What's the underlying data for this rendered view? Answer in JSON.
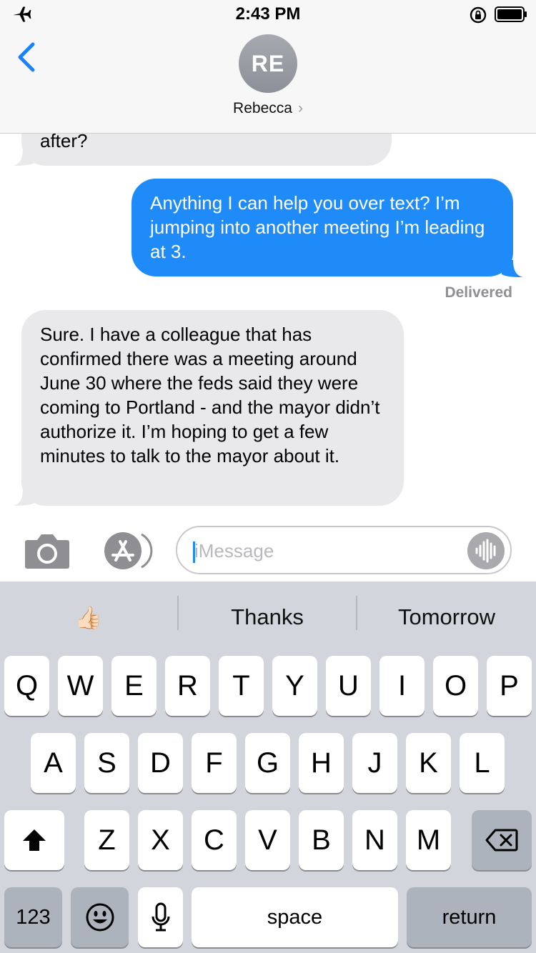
{
  "status_bar": {
    "time": "2:43 PM"
  },
  "header": {
    "back_icon": "chevron-left-icon",
    "avatar_initials": "RE",
    "contact_name": "Rebecca",
    "contact_chevron": "›"
  },
  "messages": {
    "partial_incoming": "after?",
    "outgoing": "Anything I can help you over text? I’m jumping into another meeting I’m leading at 3.",
    "delivered_label": "Delivered",
    "incoming": "Sure. I have a colleague that has confirmed there was a meeting around June 30 where the feds said they were coming to Portland -  and the mayor didn’t authorize it. I’m hoping to get a few minutes to talk to the mayor about it."
  },
  "input_bar": {
    "placeholder": "iMessage",
    "camera_icon": "camera-icon",
    "apps_icon": "app-store-icon",
    "audio_icon": "audio-waveform-icon"
  },
  "suggestions": [
    "👍🏻",
    "Thanks",
    "Tomorrow"
  ],
  "keyboard": {
    "row1": [
      "Q",
      "W",
      "E",
      "R",
      "T",
      "Y",
      "U",
      "I",
      "O",
      "P"
    ],
    "row2": [
      "A",
      "S",
      "D",
      "F",
      "G",
      "H",
      "J",
      "K",
      "L"
    ],
    "row3": [
      "Z",
      "X",
      "C",
      "V",
      "B",
      "N",
      "M"
    ],
    "numbers_label": "123",
    "space_label": "space",
    "return_label": "return",
    "emoji_icon": "emoji-icon",
    "mic_icon": "microphone-icon",
    "shift_icon": "shift-icon",
    "delete_icon": "delete-icon"
  },
  "colors": {
    "outgoing_bubble": "#1f8bf9",
    "incoming_bubble": "#e9e9eb",
    "accent": "#1a82fb",
    "keyboard_bg": "#d2d5db"
  }
}
